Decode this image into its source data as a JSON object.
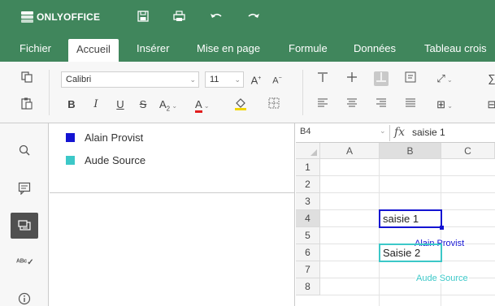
{
  "app": {
    "logo_text": "ONLYOFFICE"
  },
  "tabs": [
    {
      "label": "Fichier",
      "active": false
    },
    {
      "label": "Accueil",
      "active": true
    },
    {
      "label": "Insérer",
      "active": false
    },
    {
      "label": "Mise en page",
      "active": false
    },
    {
      "label": "Formule",
      "active": false
    },
    {
      "label": "Données",
      "active": false
    },
    {
      "label": "Tableau crois",
      "active": false
    }
  ],
  "ribbon": {
    "font_name": "Calibri",
    "font_size": "11",
    "increase_font": "A",
    "decrease_font": "A",
    "bold": "B",
    "italic": "I",
    "underline": "U",
    "strike": "S",
    "subscript": "A",
    "font_color": "A"
  },
  "collaborators": [
    {
      "name": "Alain Provist",
      "color": "#1414d2"
    },
    {
      "name": "Aude Source",
      "color": "#3cc8c8"
    }
  ],
  "formula_bar": {
    "cell_ref": "B4",
    "fx": "fx",
    "value": "saisie 1"
  },
  "sheet": {
    "columns": [
      "A",
      "B",
      "C"
    ],
    "rows": [
      "1",
      "2",
      "3",
      "4",
      "5",
      "6",
      "7",
      "8"
    ],
    "cells": {
      "B4": "saisie 1",
      "B6": "Saisie 2"
    },
    "cursor_labels": [
      {
        "name": "Alain Provist",
        "color": "#1414d2"
      },
      {
        "name": "Aude Source",
        "color": "#3cc8c8"
      }
    ]
  }
}
